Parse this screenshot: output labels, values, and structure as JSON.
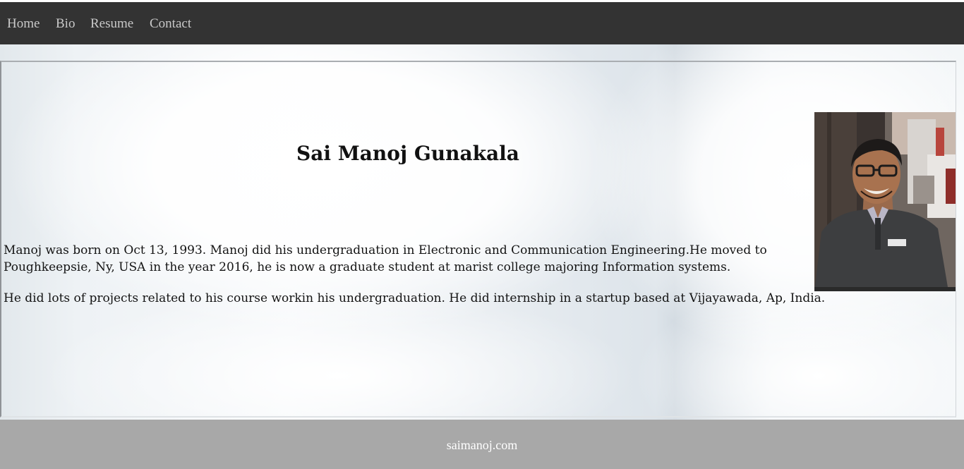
{
  "nav": {
    "items": [
      {
        "label": "Home"
      },
      {
        "label": "Bio"
      },
      {
        "label": "Resume"
      },
      {
        "label": "Contact"
      }
    ]
  },
  "main": {
    "title": "Sai Manoj Gunakala",
    "paragraphs": [
      "Manoj was born on Oct 13, 1993. Manoj did his undergraduation in Electronic and Communication Engineering.He moved to Poughkeepsie, Ny, USA in the year 2016, he is now a graduate student at marist college majoring Information systems.",
      "He did lots of projects related to his course workin his undergraduation. He did internship in a startup based at Vijayawada, Ap, India."
    ]
  },
  "footer": {
    "text": "saimanoj.com"
  },
  "colors": {
    "navbar_bg": "#333333",
    "nav_link": "#c9c9c9",
    "footer_bg": "#a8a8a8",
    "footer_text": "#ffffff"
  }
}
